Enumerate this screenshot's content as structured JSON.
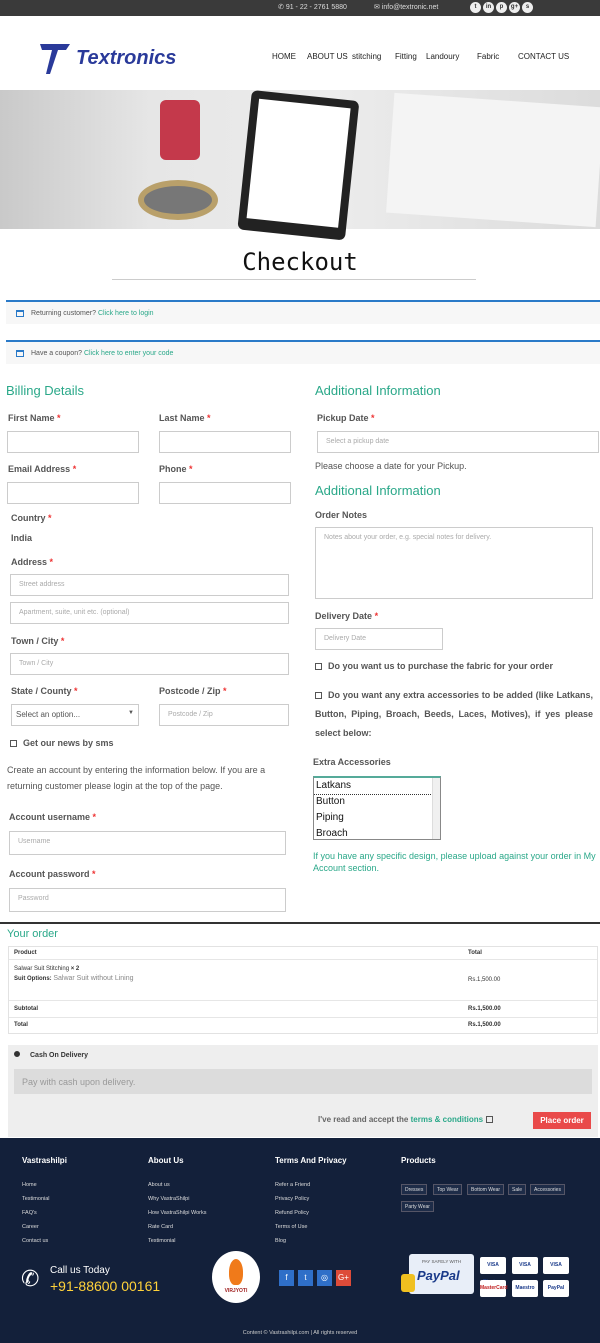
{
  "topbar": {
    "phone": "91 - 22 - 2761 5880",
    "email": "info@textronic.net",
    "social": [
      "twitter-icon",
      "linkedin-icon",
      "pinterest-icon",
      "googleplus-icon",
      "skype-icon"
    ]
  },
  "logo": {
    "text": "Textronics"
  },
  "nav": [
    "HOME",
    "ABOUT US",
    "stitching",
    "Fitting",
    "Landoury",
    "Fabric",
    "CONTACT US"
  ],
  "page_title": "Checkout",
  "notices": {
    "returning_prefix": "Returning customer?",
    "returning_link": "Click here to login",
    "coupon_prefix": "Have a coupon?",
    "coupon_link": "Click here to enter your code"
  },
  "billing": {
    "heading": "Billing Details",
    "first_name": "First Name",
    "last_name": "Last Name",
    "email": "Email Address",
    "phone": "Phone",
    "country_label": "Country",
    "country_value": "India",
    "address_label": "Address",
    "street_ph": "Street address",
    "apt_ph": "Apartment, suite, unit etc. (optional)",
    "town_label": "Town / City",
    "town_ph": "Town / City",
    "state_label": "State / County",
    "state_value": "Select an option...",
    "postcode_label": "Postcode / Zip",
    "postcode_ph": "Postcode / Zip",
    "news_label": "Get our news by sms",
    "account_note": "Create an account by entering the information below. If you are a returning customer please login at the top of the page.",
    "username_label": "Account username",
    "username_ph": "Username",
    "password_label": "Account password",
    "password_ph": "Password"
  },
  "additional": {
    "heading": "Additional Information",
    "pickup_label": "Pickup Date",
    "pickup_ph": "Select a pickup date",
    "pickup_note": "Please choose a date for your Pickup.",
    "heading2": "Additional Information",
    "notes_label": "Order Notes",
    "notes_ph": "Notes about your order, e.g. special notes for delivery.",
    "delivery_label": "Delivery Date",
    "delivery_ph": "Delivery Date",
    "fabric_q": "Do you want us to purchase the fabric for your order",
    "accessories_q": "Do you want any extra accessories to be added (like Latkans, Button, Piping, Broach, Beeds, Laces, Motives), if yes please select below:",
    "extra_label": "Extra Accessories",
    "extra_options": [
      "Latkans",
      "Button",
      "Piping",
      "Broach"
    ],
    "upload_note": "If you have any specific design, please upload against your order in My Account section."
  },
  "order": {
    "heading": "Your order",
    "col_product": "Product",
    "col_total": "Total",
    "item_name": "Salwar Suit Stitching",
    "item_qty": "× 2",
    "option_label": "Suit Options:",
    "option_value": "Salwar Suit without Lining",
    "item_total": "Rs.1,500.00",
    "subtotal_label": "Subtotal",
    "subtotal": "Rs.1,500.00",
    "total_label": "Total",
    "total": "Rs.1,500.00"
  },
  "payment": {
    "method": "Cash On Delivery",
    "message": "Pay with cash upon delivery.",
    "terms_prefix": "I've read and accept the",
    "terms_link": "terms & conditions",
    "button": "Place order"
  },
  "footer": {
    "col1_title": "Vastrashilpi",
    "col1": [
      "Home",
      "Testimonial",
      "FAQ's",
      "Career",
      "Contact us"
    ],
    "col2_title": "About Us",
    "col2": [
      "About us",
      "Why VastraShilpi",
      "How VastraShilpi Works",
      "Rate Card",
      "Testimonial"
    ],
    "col3_title": "Terms And Privacy",
    "col3": [
      "Refer a Friend",
      "Privacy Policy",
      "Refund Policy",
      "Terms of Use",
      "Blog"
    ],
    "col4_title": "Products",
    "products": [
      "Dresses",
      "Top Wear",
      "Bottom Wear",
      "Sale",
      "Accessories",
      "Party Wear"
    ],
    "call_label": "Call us Today",
    "call_number": "+91-88600 00161",
    "brand_badge": "VIRJYOTI",
    "paypal_tag": "PAY SAFELY WITH",
    "paypal": "PayPal",
    "cards": [
      "VISA Electron",
      "VISA",
      "VISA",
      "MasterCard",
      "Maestro",
      "PayPal"
    ],
    "copyright": "Content © Vastrashilpi.com | All rights reserved"
  }
}
